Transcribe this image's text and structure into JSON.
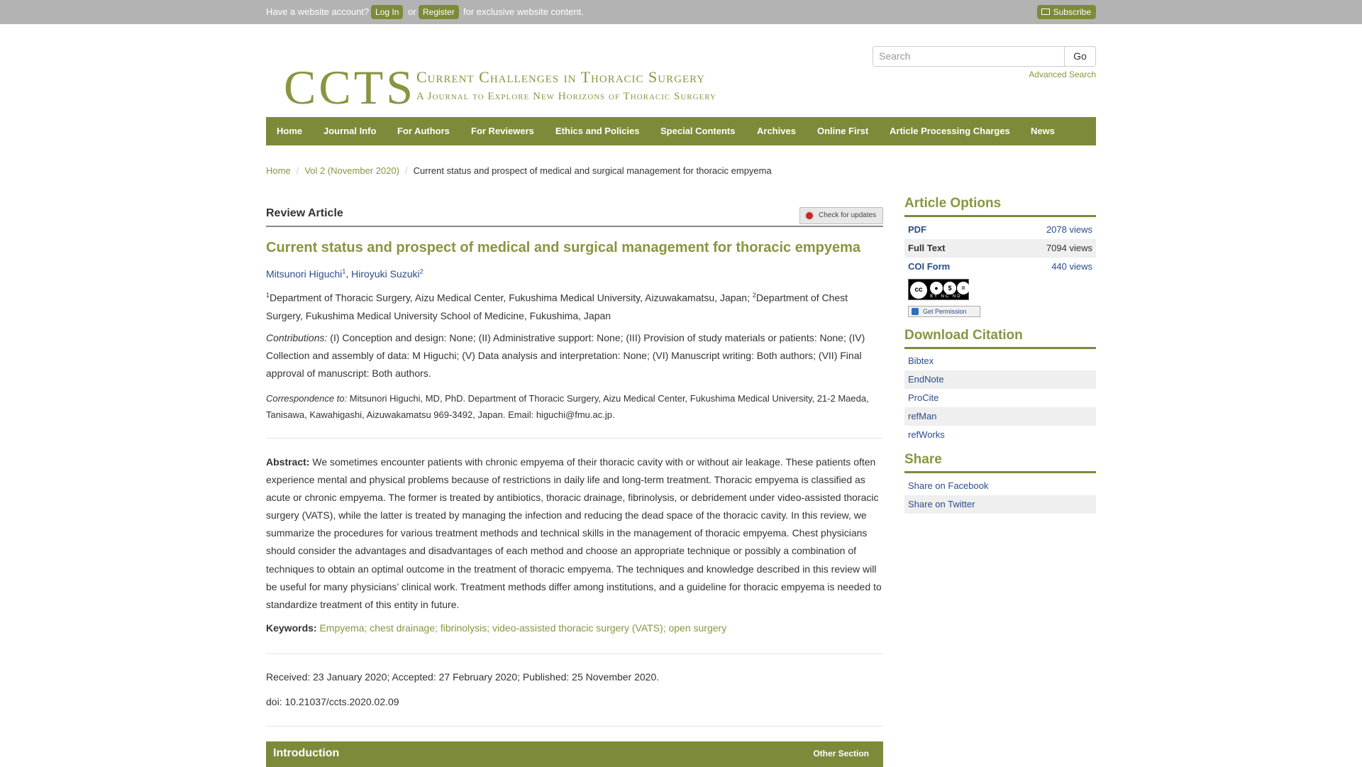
{
  "topbar": {
    "prompt": "Have a website account?",
    "login": "Log In",
    "or": "or",
    "register": "Register",
    "suffix": "for exclusive website content.",
    "subscribe": "Subscribe"
  },
  "header": {
    "logo_abbr": "CCTS",
    "logo_title": "Current Challenges in Thoracic Surgery",
    "logo_subtitle": "A Journal to Explore New Horizons of Thoracic Surgery",
    "search_placeholder": "Search",
    "search_button": "Go",
    "advanced_search": "Advanced Search"
  },
  "nav": {
    "items": [
      "Home",
      "Journal Info",
      "For Authors",
      "For Reviewers",
      "Ethics and Policies",
      "Special Contents",
      "Archives",
      "Online First",
      "Article Processing Charges",
      "News"
    ]
  },
  "breadcrumb": {
    "home": "Home",
    "volume": "Vol 2 (November 2020)",
    "current": "Current status and prospect of medical and surgical management for thoracic empyema",
    "sep": "/"
  },
  "article": {
    "type": "Review Article",
    "check_updates": "Check for updates",
    "title": "Current status and prospect of medical and surgical management for thoracic empyema",
    "authors": [
      {
        "name": "Mitsunori Higuchi",
        "sup": "1"
      },
      {
        "name": "Hiroyuki Suzuki",
        "sup": "2"
      }
    ],
    "author_sep": ", ",
    "affiliations": [
      {
        "sup": "1",
        "text": "Department of Thoracic Surgery, Aizu Medical Center, Fukushima Medical University, Aizuwakamatsu, Japan; "
      },
      {
        "sup": "2",
        "text": "Department of Chest Surgery, Fukushima Medical University School of Medicine, Fukushima, Japan"
      }
    ],
    "contributions_label": "Contributions:",
    "contributions_text": " (I) Conception and design: None; (II) Administrative support: None; (III) Provision of study materials or patients: None; (IV) Collection and assembly of data: M Higuchi; (V) Data analysis and interpretation: None; (VI) Manuscript writing: Both authors; (VII) Final approval of manuscript: Both authors.",
    "correspondence_label": "Correspondence to:",
    "correspondence_text": " Mitsunori Higuchi, MD, PhD. Department of Thoracic Surgery, Aizu Medical Center, Fukushima Medical University, 21-2 Maeda, Tanisawa, Kawahigashi, Aizuwakamatsu 969-3492, Japan. Email: higuchi@fmu.ac.jp.",
    "abstract_label": "Abstract:",
    "abstract_text": " We sometimes encounter patients with chronic empyema of their thoracic cavity with or without air leakage. These patients often experience mental and physical problems because of restrictions in daily life and long-term treatment. Thoracic empyema is classified as acute or chronic empyema. The former is treated by antibiotics, thoracic drainage, fibrinolysis, or debridement under video-assisted thoracic surgery (VATS), while the latter is treated by managing the infection and reducing the dead space of the thoracic cavity. In this review, we summarize the procedures for various treatment methods and technical skills in the management of thoracic empyema. Chest physicians should consider the advantages and disadvantages of each method and choose an appropriate technique or possibly a combination of techniques to obtain an optimal outcome in the treatment of thoracic empyema. The techniques and knowledge described in this review will be useful for many physicians’ clinical work. Treatment methods differ among institutions, and a guideline for thoracic empyema is needed to standardize treatment of this entity in future.",
    "keywords_label": "Keywords:",
    "keywords_text": "Empyema; chest drainage; fibrinolysis; video-assisted thoracic surgery (VATS); open surgery",
    "dates": "Received: 23 January 2020; Accepted: 27 February 2020; Published: 25 November 2020.",
    "doi": "doi: 10.21037/ccts.2020.02.09",
    "section_title": "Introduction",
    "other_section": "Other Section"
  },
  "sidebar": {
    "article_options_title": "Article Options",
    "options": [
      {
        "label": "PDF",
        "views": "2078 views"
      },
      {
        "label": "Full Text",
        "views": "7094 views"
      },
      {
        "label": "COI Form",
        "views": "440 views"
      }
    ],
    "cc_label": "cc",
    "cc_tags": "BY NC ND",
    "get_permission": "Get Permission",
    "download_title": "Download Citation",
    "citations": [
      "Bibtex",
      "EndNote",
      "ProCite",
      "refMan",
      "refWorks"
    ],
    "share_title": "Share",
    "share": [
      "Share on Facebook",
      "Share on Twitter"
    ]
  },
  "colors": {
    "brand_olive": "#7d8a3a",
    "link_olive": "#8b9440",
    "link_blue": "#2b4d8c",
    "topbar_gray": "#b3b3b3"
  }
}
